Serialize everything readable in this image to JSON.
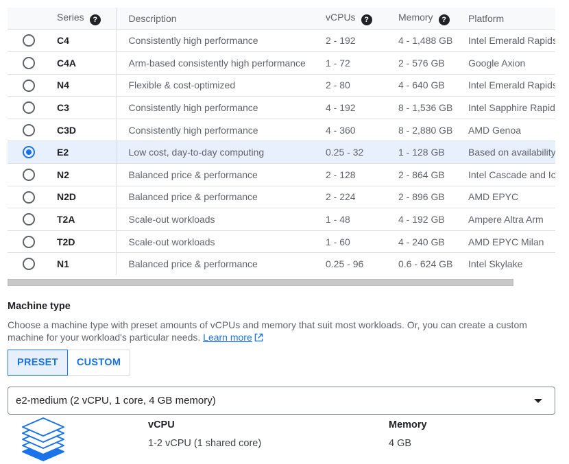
{
  "table": {
    "headers": {
      "series": "Series",
      "description": "Description",
      "vcpus": "vCPUs",
      "memory": "Memory",
      "platform": "Platform"
    },
    "rows": [
      {
        "series": "C4",
        "description": "Consistently high performance",
        "vcpus": "2 - 192",
        "memory": "4 - 1,488 GB",
        "platform": "Intel Emerald Rapids",
        "selected": false
      },
      {
        "series": "C4A",
        "description": "Arm-based consistently high performance",
        "vcpus": "1 - 72",
        "memory": "2 - 576 GB",
        "platform": "Google Axion",
        "selected": false
      },
      {
        "series": "N4",
        "description": "Flexible & cost-optimized",
        "vcpus": "2 - 80",
        "memory": "4 - 640 GB",
        "platform": "Intel Emerald Rapids",
        "selected": false
      },
      {
        "series": "C3",
        "description": "Consistently high performance",
        "vcpus": "4 - 192",
        "memory": "8 - 1,536 GB",
        "platform": "Intel Sapphire Rapids",
        "selected": false
      },
      {
        "series": "C3D",
        "description": "Consistently high performance",
        "vcpus": "4 - 360",
        "memory": "8 - 2,880 GB",
        "platform": "AMD Genoa",
        "selected": false
      },
      {
        "series": "E2",
        "description": "Low cost, day-to-day computing",
        "vcpus": "0.25 - 32",
        "memory": "1 - 128 GB",
        "platform": "Based on availability",
        "selected": true
      },
      {
        "series": "N2",
        "description": "Balanced price & performance",
        "vcpus": "2 - 128",
        "memory": "2 - 864 GB",
        "platform": "Intel Cascade and Ice Lake",
        "selected": false
      },
      {
        "series": "N2D",
        "description": "Balanced price & performance",
        "vcpus": "2 - 224",
        "memory": "2 - 896 GB",
        "platform": "AMD EPYC",
        "selected": false
      },
      {
        "series": "T2A",
        "description": "Scale-out workloads",
        "vcpus": "1 - 48",
        "memory": "4 - 192 GB",
        "platform": "Ampere Altra Arm",
        "selected": false
      },
      {
        "series": "T2D",
        "description": "Scale-out workloads",
        "vcpus": "1 - 60",
        "memory": "4 - 240 GB",
        "platform": "AMD EPYC Milan",
        "selected": false
      },
      {
        "series": "N1",
        "description": "Balanced price & performance",
        "vcpus": "0.25 - 96",
        "memory": "0.6 - 624 GB",
        "platform": "Intel Skylake",
        "selected": false
      }
    ]
  },
  "machine_type": {
    "title": "Machine type",
    "description": "Choose a machine type with preset amounts of vCPUs and memory that suit most workloads. Or, you can create a custom machine for your workload's particular needs.",
    "learn_more": "Learn more",
    "tabs": {
      "preset": "PRESET",
      "custom": "CUSTOM"
    },
    "selected": "e2-medium (2 vCPU, 1 core, 4 GB memory)",
    "specs": {
      "vcpu_label": "vCPU",
      "vcpu_value": "1-2 vCPU (1 shared core)",
      "memory_label": "Memory",
      "memory_value": "4 GB"
    }
  },
  "icons": {
    "help": "help-icon",
    "external_link": "external-link-icon",
    "dropdown": "chevron-down-icon",
    "machine": "stacked-layers-icon"
  },
  "colors": {
    "accent": "#1a73e8",
    "selected_row": "#e8f0fe",
    "header_bg": "#f8f9fa"
  }
}
